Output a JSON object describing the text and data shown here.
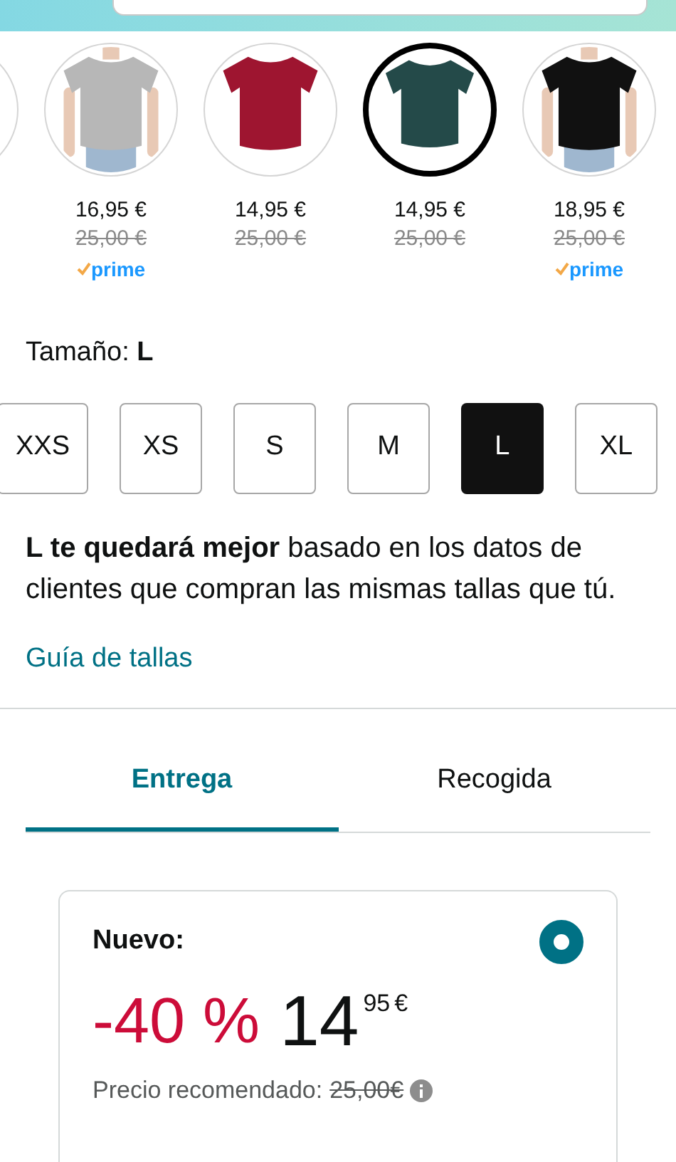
{
  "swatches": [
    {
      "selected": false
    },
    {
      "kind": "picture",
      "color": "#b7b7b7",
      "selected": false,
      "price": "16,95 €",
      "list_price": "25,00 €",
      "prime": "prime"
    },
    {
      "kind": "picture",
      "color": "#9e1530",
      "selected": false,
      "price": "14,95 €",
      "list_price": "25,00 €"
    },
    {
      "kind": "picture",
      "color": "#244a49",
      "selected": true,
      "price": "14,95 €",
      "list_price": "25,00 €"
    },
    {
      "kind": "picture",
      "color": "#111111",
      "selected": false,
      "price": "18,95 €",
      "list_price": "25,00 €",
      "prime": "prime"
    }
  ],
  "size_label": "Tamaño: **L**",
  "sizes": [
    {
      "label": "XXS",
      "selected": false
    },
    {
      "label": "XS",
      "selected": false
    },
    {
      "label": "S",
      "selected": false
    },
    {
      "label": "M",
      "selected": false
    },
    {
      "label": "L",
      "selected": true
    },
    {
      "label": "XL",
      "selected": false
    }
  ],
  "fit_note": "**L te quedará mejor** basado en los datos de clientes que compran las mismas tallas que tú.",
  "size_guide_link": "Guía de tallas",
  "tabs": [
    {
      "label": "Entrega",
      "selected": true
    },
    {
      "label": "Recogida",
      "selected": false
    }
  ],
  "offer": {
    "title": "Nuevo:",
    "selected": true,
    "discount": "-40 %",
    "price_whole": "14",
    "price_fraction": "95",
    "currency": "€",
    "list_price_label": "Precio recomendado:",
    "list_price": "25,00€"
  }
}
